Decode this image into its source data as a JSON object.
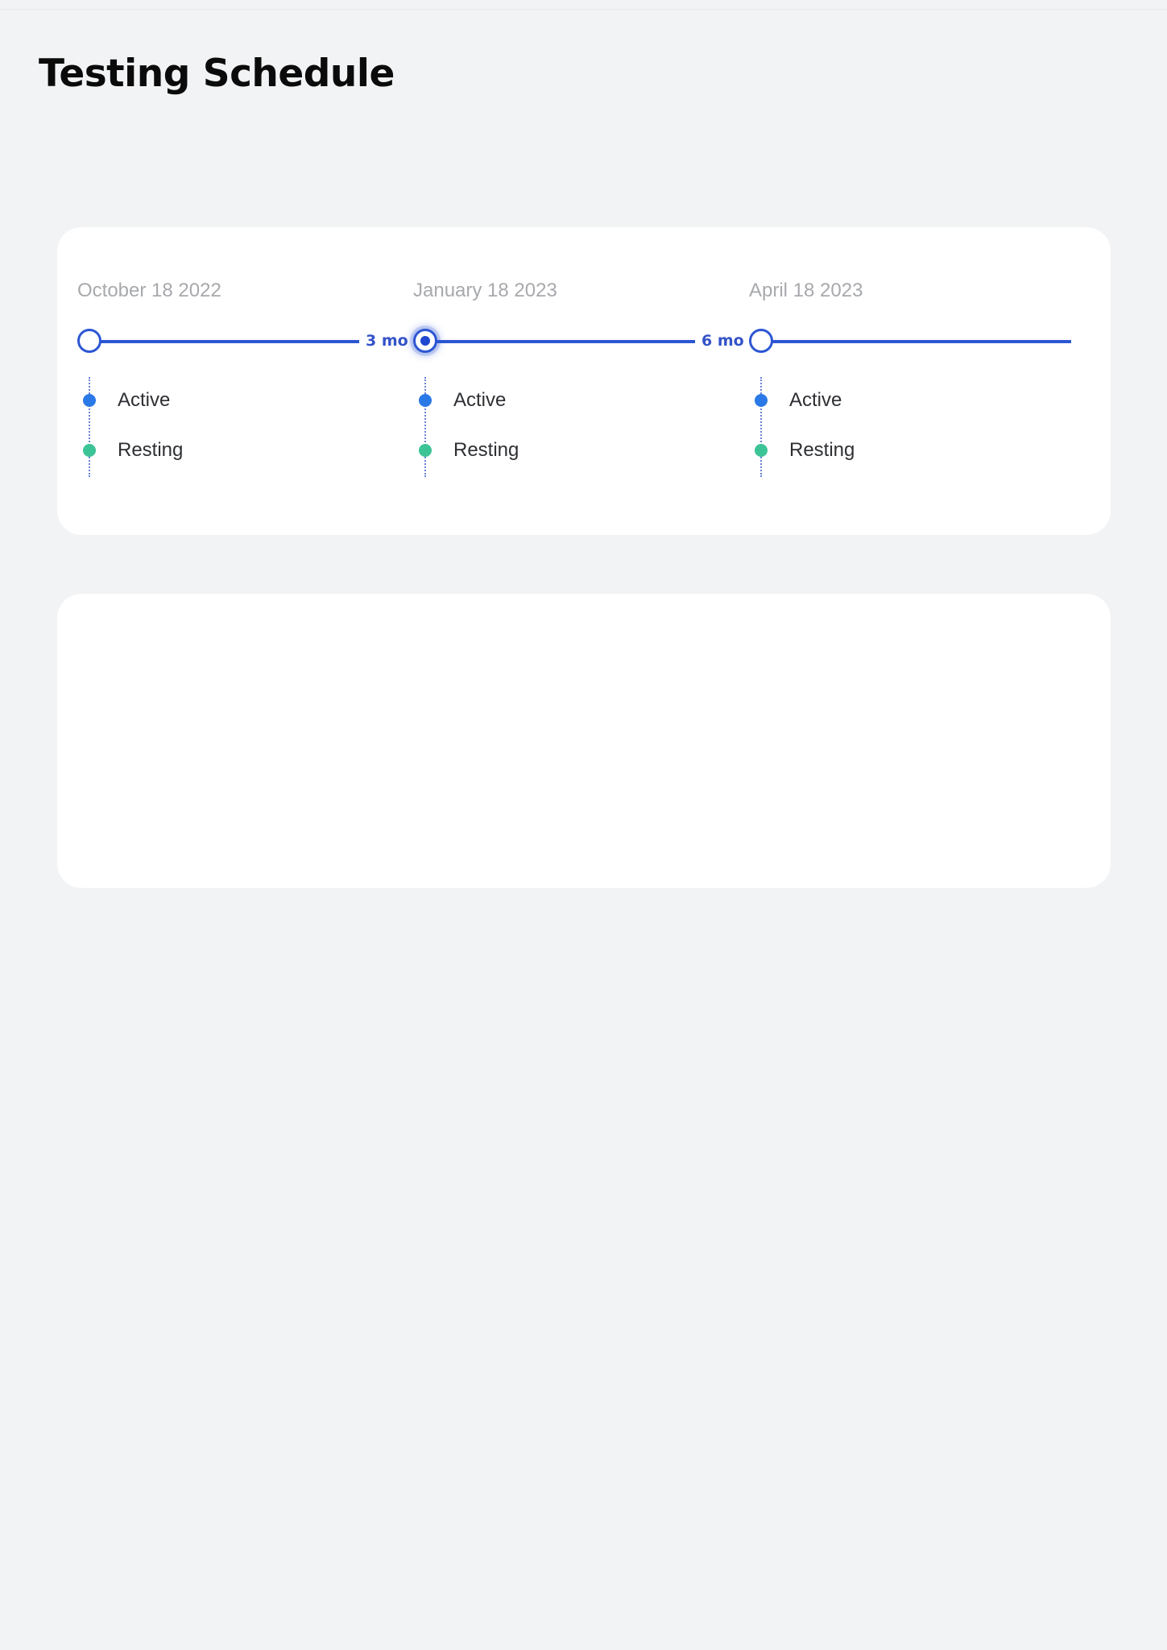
{
  "page": {
    "title": "Testing Schedule"
  },
  "colors": {
    "accent": "#2c56d3",
    "active_dot": "#2b79e6",
    "resting_dot": "#3cc497",
    "card_bg": "#ffffff",
    "page_bg": "#f1f3f5"
  },
  "timeline": {
    "checkpoints": [
      {
        "date": "October 18 2022",
        "selected": false,
        "phases": [
          {
            "label": "Active",
            "icon": "active-dot"
          },
          {
            "label": "Resting",
            "icon": "resting-dot"
          }
        ]
      },
      {
        "date": "January 18 2023",
        "selected": true,
        "phases": [
          {
            "label": "Active",
            "icon": "active-dot"
          },
          {
            "label": "Resting",
            "icon": "resting-dot"
          }
        ]
      },
      {
        "date": "April 18 2023",
        "selected": false,
        "phases": [
          {
            "label": "Active",
            "icon": "active-dot"
          },
          {
            "label": "Resting",
            "icon": "resting-dot"
          }
        ]
      }
    ],
    "intervals": [
      "3 mo",
      "6 mo"
    ]
  }
}
